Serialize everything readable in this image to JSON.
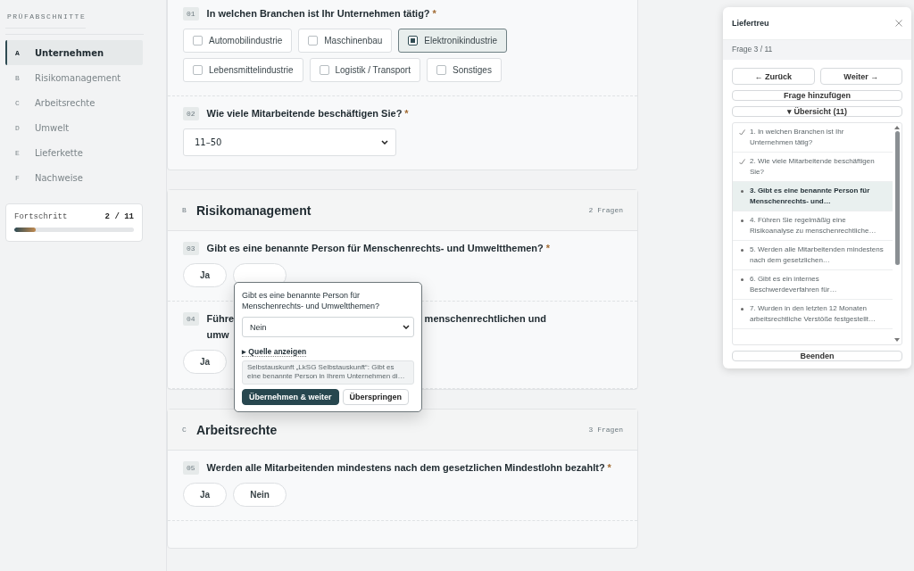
{
  "sidebar": {
    "heading": "PRÜFABSCHNITTE",
    "items": [
      {
        "letter": "A",
        "label": "Unternehmen",
        "selected": true
      },
      {
        "letter": "B",
        "label": "Risikomanagement",
        "selected": false
      },
      {
        "letter": "C",
        "label": "Arbeitsrechte",
        "selected": false
      },
      {
        "letter": "D",
        "label": "Umwelt",
        "selected": false
      },
      {
        "letter": "E",
        "label": "Lieferkette",
        "selected": false
      },
      {
        "letter": "F",
        "label": "Nachweise",
        "selected": false
      }
    ],
    "progress": {
      "label": "Fortschritt",
      "count": "2 / 11",
      "level": 0.18
    }
  },
  "sections": [
    {
      "questions": [
        {
          "number": "01",
          "title": "In welchen Branchen ist Ihr Unternehmen tätig?",
          "marker": "*",
          "kind": "multi",
          "options": [
            {
              "label": "Automobilindustrie",
              "checked": false
            },
            {
              "label": "Maschinenbau",
              "checked": false
            },
            {
              "label": "Elektronikindustrie",
              "checked": true
            },
            {
              "label": "Lebensmittelindustrie",
              "checked": false
            },
            {
              "label": "Logistik / Transport",
              "checked": false
            },
            {
              "label": "Sonstiges",
              "checked": false
            }
          ]
        },
        {
          "number": "02",
          "title": "Wie viele Mitarbeitende beschäftigen Sie?",
          "marker": "*",
          "kind": "select",
          "value": "11–50"
        }
      ]
    },
    {
      "letter": "B",
      "title": "Risikomanagement",
      "count": "2 Fragen",
      "questions": [
        {
          "number": "03",
          "title": "Gibt es eine benannte Person für Menschenrechts- und Umweltthemen?",
          "marker": "*",
          "kind": "yesno",
          "options": [
            {
              "kind": "answer",
              "label": "Ja"
            },
            {
              "kind": "blank"
            }
          ]
        },
        {
          "number": "04",
          "title_parts": [
            "Führe",
            "menschenrechtlichen und",
            "umw"
          ],
          "kind": "yesno",
          "options": [
            {
              "kind": "answer",
              "label": "Ja"
            }
          ]
        }
      ],
      "popup": {
        "question": "Gibt es eine benannte Person für Menschenrechts- und Umweltthemen?",
        "value": "Nein",
        "source_toggle": "▸ Quelle anzeigen",
        "source_text": "Selbstauskunft „LkSG Selbstauskunft“: Gibt es eine benannte Person in Ihrem Unternehmen di…",
        "buttons": [
          {
            "label": "Übernehmen & weiter",
            "kind": "primary"
          },
          {
            "label": "Überspringen",
            "kind": "secondary"
          }
        ]
      }
    },
    {
      "letter": "C",
      "title": "Arbeitsrechte",
      "count": "3 Fragen",
      "questions": [
        {
          "number": "05",
          "title": "Werden alle Mitarbeitenden mindestens nach dem gesetzlichen Mindestlohn bezahlt?",
          "marker": "*",
          "kind": "yesno",
          "options": [
            {
              "kind": "answer",
              "label": "Ja"
            },
            {
              "kind": "answer",
              "label": "Nein"
            }
          ]
        }
      ]
    }
  ],
  "assistant": {
    "title": "Liefertreu",
    "progress": "Frage 3 / 11",
    "nav": [
      "← Zurück",
      "Weiter →"
    ],
    "add": "Frage hinzufügen",
    "overview": "▾ Übersicht (11)",
    "items": [
      {
        "text": "1. In welchen Branchen ist Ihr Unternehmen tätig?",
        "done": true,
        "selected": false
      },
      {
        "text": "2. Wie viele Mitarbeitende beschäftigen Sie?",
        "done": true,
        "selected": false
      },
      {
        "text": "3. Gibt es eine benannte Person für Menschenrechts- und…",
        "done": false,
        "selected": true
      },
      {
        "text": "4. Führen Sie regelmäßig eine Risikoanalyse zu menschenrechtliche…",
        "done": false,
        "selected": false
      },
      {
        "text": "5. Werden alle Mitarbeitenden mindestens nach dem gesetzlichen…",
        "done": false,
        "selected": false
      },
      {
        "text": "6. Gibt es ein internes Beschwerdeverfahren für…",
        "done": false,
        "selected": false
      },
      {
        "text": "7. Wurden in den letzten 12 Monaten arbeitsrechtliche Verstöße festgestellt…",
        "done": false,
        "selected": false
      }
    ],
    "finish": "Beenden"
  }
}
